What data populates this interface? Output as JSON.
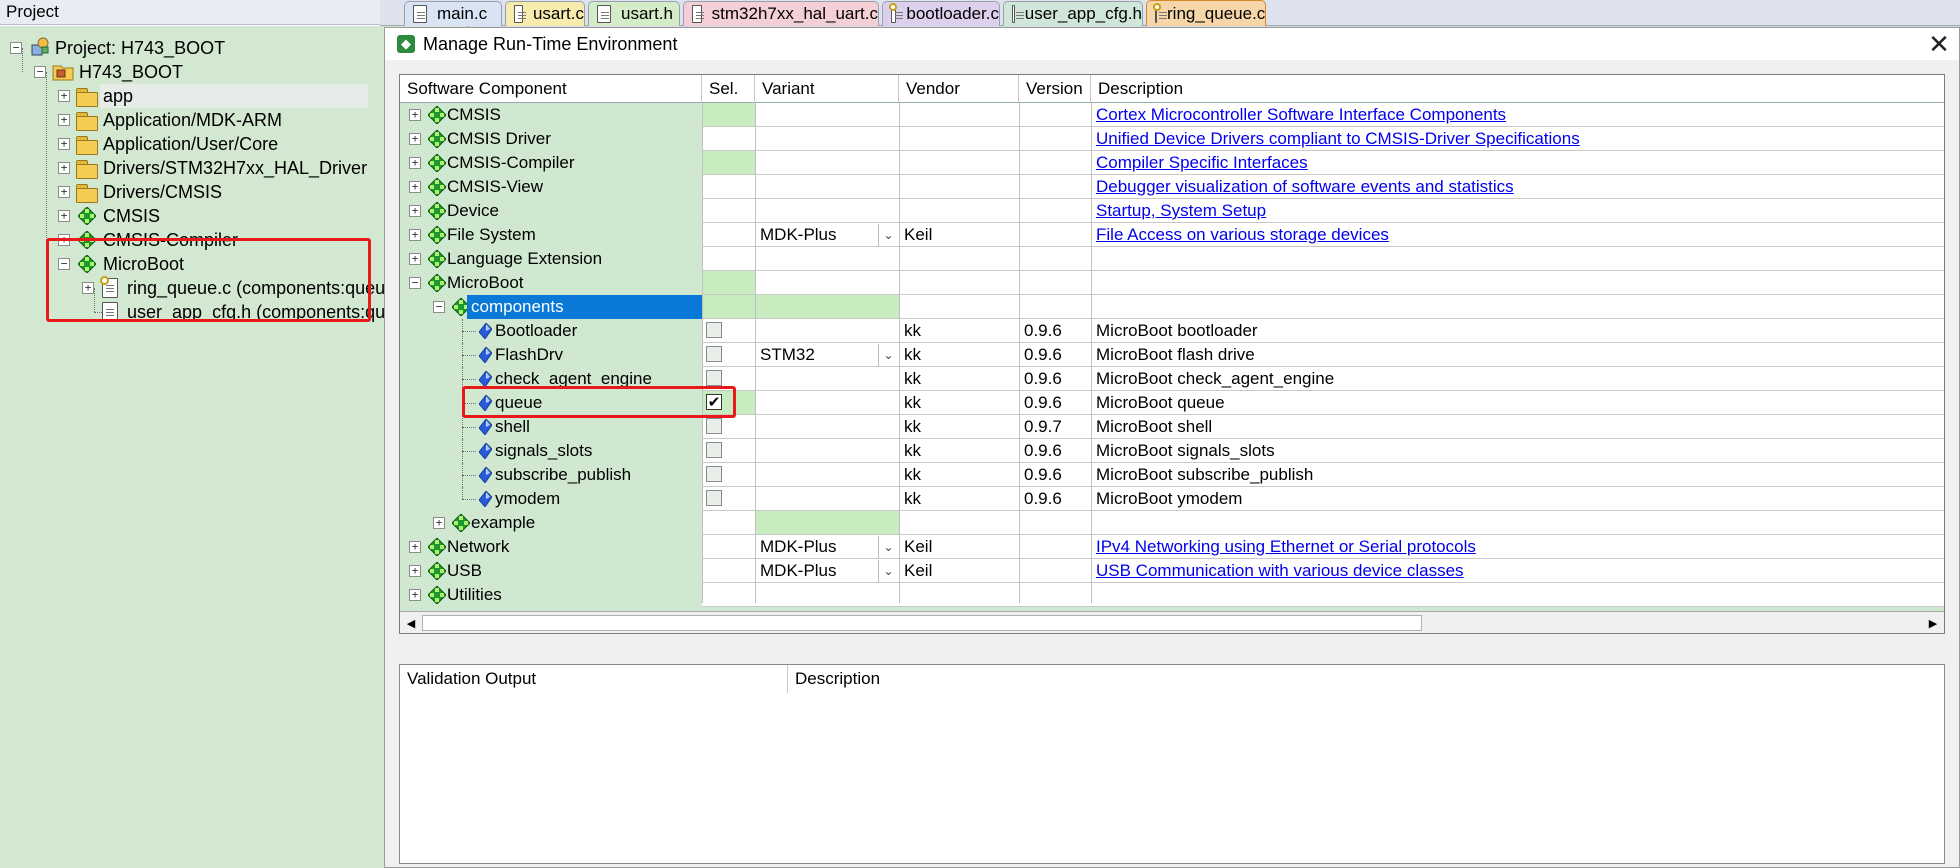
{
  "project_pane": {
    "title": "Project",
    "pin_glyph": "⊢",
    "close_glyph": "×",
    "items": [
      {
        "label": "Project: H743_BOOT",
        "icon": "project-icon"
      },
      {
        "label": "H743_BOOT",
        "icon": "target-folder-icon"
      },
      {
        "label": "app",
        "icon": "folder-icon"
      },
      {
        "label": "Application/MDK-ARM",
        "icon": "folder-icon"
      },
      {
        "label": "Application/User/Core",
        "icon": "folder-icon"
      },
      {
        "label": "Drivers/STM32H7xx_HAL_Driver",
        "icon": "folder-icon"
      },
      {
        "label": "Drivers/CMSIS",
        "icon": "folder-icon"
      },
      {
        "label": "CMSIS",
        "icon": "component-icon"
      },
      {
        "label": "CMSIS-Compiler",
        "icon": "component-icon"
      },
      {
        "label": "MicroBoot",
        "icon": "component-icon"
      },
      {
        "label": "ring_queue.c (components:queue)",
        "icon": "config-file-icon"
      },
      {
        "label": "user_app_cfg.h (components:queue)",
        "icon": "file-icon"
      }
    ]
  },
  "editor_tabs": [
    {
      "label": "main.c",
      "color": "#d8e4f4"
    },
    {
      "label": "usart.c",
      "color": "#f7ecae"
    },
    {
      "label": "usart.h",
      "color": "#d4ecc8"
    },
    {
      "label": "stm32h7xx_hal_uart.c",
      "color": "#f4d0d6"
    },
    {
      "label": "bootloader.c",
      "color": "#dcd0ec"
    },
    {
      "label": "user_app_cfg.h",
      "color": "#cfe6d8"
    },
    {
      "label": "ring_queue.c",
      "color": "#f6d6a8"
    }
  ],
  "dialog": {
    "title": "Manage Run-Time Environment",
    "close_glyph": "✕",
    "columns": [
      "Software Component",
      "Sel.",
      "Variant",
      "Vendor",
      "Version",
      "Description"
    ],
    "rows": [
      {
        "name": "CMSIS",
        "level": 0,
        "exp": "+",
        "sel": "",
        "variant": "",
        "vendor": "",
        "version": "",
        "desc": "Cortex Microcontroller Software Interface Components",
        "link": true,
        "selgreen": true
      },
      {
        "name": "CMSIS Driver",
        "level": 0,
        "exp": "+",
        "sel": "",
        "variant": "",
        "vendor": "",
        "version": "",
        "desc": "Unified Device Drivers compliant to CMSIS-Driver Specifications",
        "link": true
      },
      {
        "name": "CMSIS-Compiler",
        "level": 0,
        "exp": "+",
        "sel": "",
        "variant": "",
        "vendor": "",
        "version": "",
        "desc": "Compiler Specific Interfaces",
        "link": true,
        "selgreen": true
      },
      {
        "name": "CMSIS-View",
        "level": 0,
        "exp": "+",
        "sel": "",
        "variant": "",
        "vendor": "",
        "version": "",
        "desc": "Debugger visualization of software events and statistics",
        "link": true
      },
      {
        "name": "Device",
        "level": 0,
        "exp": "+",
        "sel": "",
        "variant": "",
        "vendor": "",
        "version": "",
        "desc": "Startup, System Setup",
        "link": true
      },
      {
        "name": "File System",
        "level": 0,
        "exp": "+",
        "sel": "",
        "variant": "MDK-Plus",
        "vendor": "Keil",
        "version": "",
        "desc": "File Access on various storage devices",
        "link": true,
        "dropdown": true
      },
      {
        "name": "Language Extension",
        "level": 0,
        "exp": "+",
        "sel": "",
        "variant": "",
        "vendor": "",
        "version": "",
        "desc": "",
        "link": false
      },
      {
        "name": "MicroBoot",
        "level": 0,
        "exp": "−",
        "sel": "",
        "variant": "",
        "vendor": "",
        "version": "",
        "desc": "",
        "link": false,
        "selgreen": true
      },
      {
        "name": "components",
        "level": 1,
        "exp": "−",
        "sel": "",
        "variant": "",
        "vendor": "",
        "version": "",
        "desc": "",
        "link": false,
        "selected": true,
        "selgreen": true,
        "vargreen": true
      },
      {
        "name": "Bootloader",
        "level": 2,
        "exp": "",
        "sel": "box",
        "variant": "",
        "vendor": "kk",
        "version": "0.9.6",
        "desc": "MicroBoot bootloader",
        "link": false
      },
      {
        "name": "FlashDrv",
        "level": 2,
        "exp": "",
        "sel": "box",
        "variant": "STM32",
        "vendor": "kk",
        "version": "0.9.6",
        "desc": "MicroBoot flash drive",
        "link": false,
        "dropdown": true
      },
      {
        "name": "check_agent_engine",
        "level": 2,
        "exp": "",
        "sel": "box",
        "variant": "",
        "vendor": "kk",
        "version": "0.9.6",
        "desc": "MicroBoot check_agent_engine",
        "link": false
      },
      {
        "name": "queue",
        "level": 2,
        "exp": "",
        "sel": "checked",
        "variant": "",
        "vendor": "kk",
        "version": "0.9.6",
        "desc": "MicroBoot queue",
        "link": false,
        "selgreen": true
      },
      {
        "name": "shell",
        "level": 2,
        "exp": "",
        "sel": "box",
        "variant": "",
        "vendor": "kk",
        "version": "0.9.7",
        "desc": "MicroBoot shell",
        "link": false
      },
      {
        "name": "signals_slots",
        "level": 2,
        "exp": "",
        "sel": "box",
        "variant": "",
        "vendor": "kk",
        "version": "0.9.6",
        "desc": "MicroBoot signals_slots",
        "link": false
      },
      {
        "name": "subscribe_publish",
        "level": 2,
        "exp": "",
        "sel": "box",
        "variant": "",
        "vendor": "kk",
        "version": "0.9.6",
        "desc": "MicroBoot subscribe_publish",
        "link": false
      },
      {
        "name": "ymodem",
        "level": 2,
        "exp": "",
        "sel": "box",
        "variant": "",
        "vendor": "kk",
        "version": "0.9.6",
        "desc": "MicroBoot ymodem",
        "link": false
      },
      {
        "name": "example",
        "level": 1,
        "exp": "+",
        "sel": "",
        "variant": "",
        "vendor": "",
        "version": "",
        "desc": "",
        "link": false,
        "vargreen": true
      },
      {
        "name": "Network",
        "level": 0,
        "exp": "+",
        "sel": "",
        "variant": "MDK-Plus",
        "vendor": "Keil",
        "version": "",
        "desc": "IPv4 Networking using Ethernet or Serial protocols",
        "link": true,
        "dropdown": true
      },
      {
        "name": "USB",
        "level": 0,
        "exp": "+",
        "sel": "",
        "variant": "MDK-Plus",
        "vendor": "Keil",
        "version": "",
        "desc": "USB Communication with various device classes",
        "link": true,
        "dropdown": true
      },
      {
        "name": "Utilities",
        "level": 0,
        "exp": "+",
        "sel": "",
        "variant": "",
        "vendor": "",
        "version": "",
        "desc": "",
        "link": false
      }
    ],
    "scroll_left_glyph": "◀",
    "scroll_right_glyph": "▶",
    "validation_columns": [
      "Validation Output",
      "Description"
    ]
  }
}
